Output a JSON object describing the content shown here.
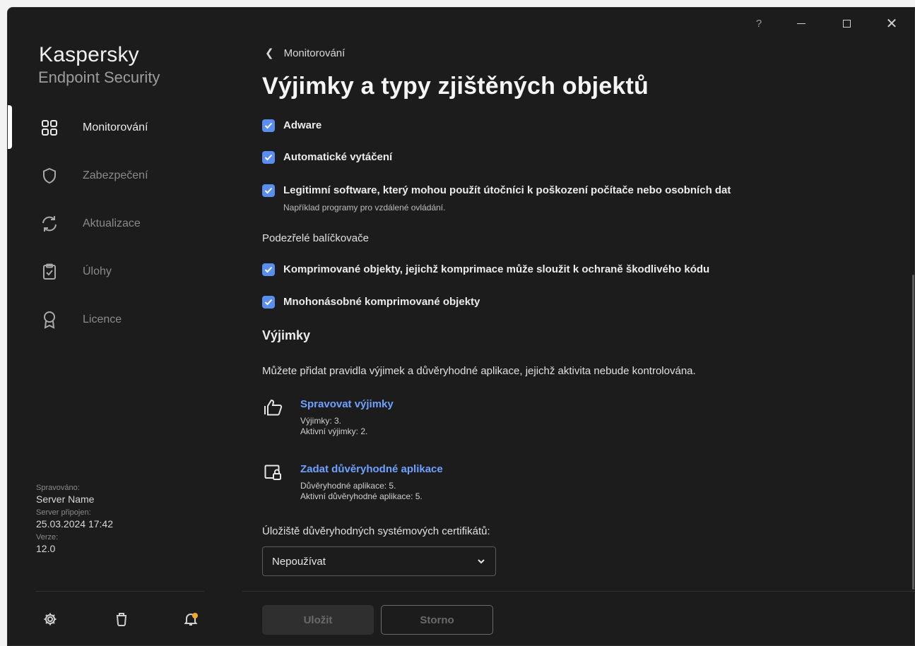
{
  "window": {
    "help_label": "?",
    "close_label": "✕"
  },
  "sidebar": {
    "brand_line1": "Kaspersky",
    "brand_line2": "Endpoint Security",
    "items": [
      {
        "label": "Monitorování",
        "icon": "grid-icon"
      },
      {
        "label": "Zabezpečení",
        "icon": "shield-icon"
      },
      {
        "label": "Aktualizace",
        "icon": "refresh-icon"
      },
      {
        "label": "Úlohy",
        "icon": "clipboard-check-icon"
      },
      {
        "label": "Licence",
        "icon": "award-icon"
      }
    ],
    "meta": {
      "managed_key": "Spravováno:",
      "managed_value": "Server Name",
      "connected_key": "Server připojen:",
      "connected_value": "25.03.2024 17:42",
      "version_key": "Verze:",
      "version_value": "12.0"
    },
    "bottom_icons": [
      "settings-icon",
      "support-icon",
      "notifications-icon"
    ],
    "notification_dot_color": "#f0a92b"
  },
  "header": {
    "back_label": "Monitorování",
    "title": "Výjimky a typy zjištěných objektů"
  },
  "content": {
    "checkboxes": [
      {
        "label": "Adware",
        "checked": true
      },
      {
        "label": "Automatické vytáčení",
        "checked": true
      },
      {
        "label": "Legitimní software, který mohou použít útočníci k poškození počítače nebo osobních dat",
        "sub": "Například programy pro vzdálené ovládání.",
        "checked": true
      },
      {
        "label": "Komprimované objekty, jejichž komprimace může sloužit k ochraně škodlivého kódu",
        "checked": true
      },
      {
        "label": "Mnohonásobné komprimované objekty",
        "checked": true
      }
    ],
    "packers_heading": "Podezřelé balíčkovače",
    "exclusions_heading": "Výjimky",
    "exclusions_desc": "Můžete přidat pravidla výjimek a důvěryhodné aplikace, jejichž aktivita nebude kontrolována.",
    "manage_exclusions": {
      "label": "Spravovat výjimky",
      "line1": "Výjimky: 3.",
      "line2": "Aktivní výjimky: 2."
    },
    "trusted_apps": {
      "label": "Zadat důvěryhodné aplikace",
      "line1": "Důvěryhodné aplikace: 5.",
      "line2": "Aktivní důvěryhodné aplikace: 5."
    },
    "cert_store_label": "Úložiště důvěryhodných systémových certifikátů:",
    "cert_store_value": "Nepoužívat"
  },
  "footer": {
    "save_label": "Uložit",
    "cancel_label": "Storno"
  },
  "colors": {
    "accent": "#5a8df0",
    "link": "#6fa1ff",
    "background": "#1c1c1c"
  }
}
